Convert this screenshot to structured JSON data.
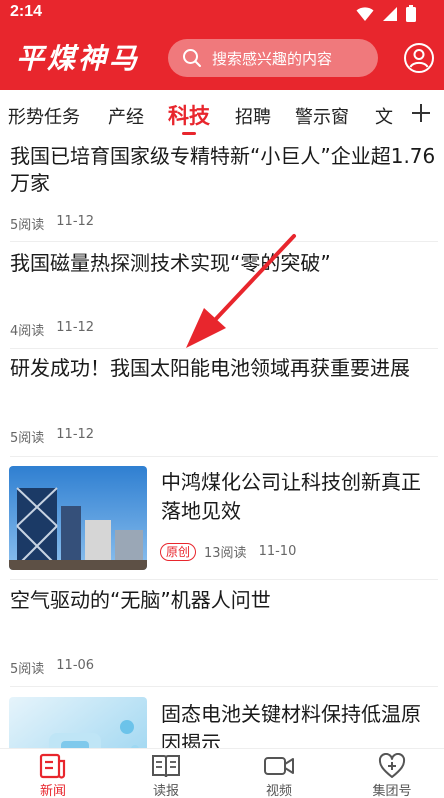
{
  "status": {
    "time": "2:14"
  },
  "header": {
    "logo_text": "平煤神马",
    "search_placeholder": "搜索感兴趣的内容"
  },
  "tabs": [
    {
      "label": "形势任务",
      "active": false
    },
    {
      "label": "产经",
      "active": false
    },
    {
      "label": "科技",
      "active": true
    },
    {
      "label": "招聘",
      "active": false
    },
    {
      "label": "警示窗",
      "active": false
    },
    {
      "label": "文",
      "active": false
    }
  ],
  "feed": [
    {
      "title": "我国已培育国家级专精特新“小巨人”企业超1.76万家",
      "reads": "5阅读",
      "date": "11-12"
    },
    {
      "title": "我国磁量热探测技术实现“零的突破”",
      "reads": "4阅读",
      "date": "11-12"
    },
    {
      "title": "研发成功！我国太阳能电池领域再获重要进展",
      "reads": "5阅读",
      "date": "11-12"
    },
    {
      "title": "中鸿煤化公司让科技创新真正落地见效",
      "badge": "原创",
      "reads": "13阅读",
      "date": "11-10"
    },
    {
      "title": "空气驱动的“无脑”机器人问世",
      "reads": "5阅读",
      "date": "11-06"
    },
    {
      "title": "固态电池关键材料保持低温原因揭示"
    }
  ],
  "bottom_nav": [
    {
      "label": "新闻",
      "active": true
    },
    {
      "label": "读报",
      "active": false
    },
    {
      "label": "视频",
      "active": false
    },
    {
      "label": "集团号",
      "active": false
    }
  ],
  "colors": {
    "brand_red": "#e8262d"
  }
}
